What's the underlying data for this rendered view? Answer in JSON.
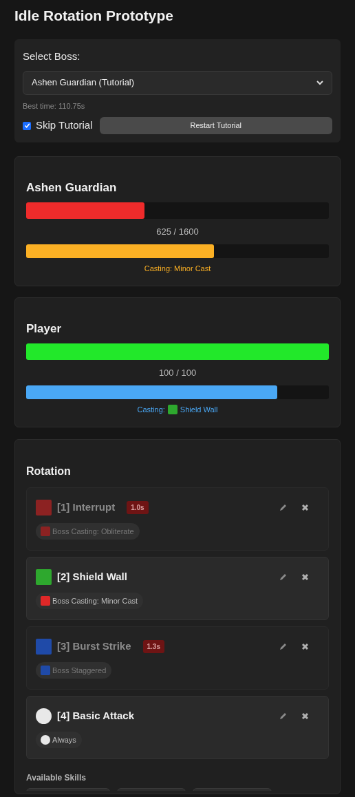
{
  "title": "Idle Rotation Prototype",
  "settings": {
    "label": "Select Boss:",
    "boss_select": "Ashen Guardian (Tutorial)",
    "best_time": "Best time: 110.75s",
    "skip_tutorial": {
      "label": "Skip Tutorial",
      "checked": true
    },
    "restart_button": "Restart Tutorial"
  },
  "units": [
    {
      "name": "Ashen Guardian",
      "kind": "boss",
      "health": {
        "level": 0.39,
        "color": "#ef2b2b"
      },
      "health_text": "625 / 1600",
      "cast": {
        "level": 0.62,
        "color": "#fbb024"
      },
      "cast_label": "Casting: Minor Cast"
    },
    {
      "name": "Player",
      "kind": "player",
      "health": {
        "level": 1.0,
        "color": "#22e82a"
      },
      "health_text": "100 / 100",
      "cast": {
        "level": 0.83,
        "color": "#4aa8f5"
      },
      "cast_label": "Casting:",
      "cast_skill": {
        "name": "Shield Wall",
        "color": "#2ea82e"
      }
    }
  ],
  "rotation": {
    "title": "Rotation",
    "items": [
      {
        "label": "[1] Interrupt",
        "kind": "square",
        "color": "#8c2222",
        "dimmed": true,
        "cooldown": "1.0s",
        "condition": {
          "text": "Boss Casting: Obliterate",
          "kind": "square",
          "color": "#8c2222"
        }
      },
      {
        "label": "[2] Shield Wall",
        "kind": "square",
        "color": "#2ea82e",
        "dimmed": false,
        "condition": {
          "text": "Boss Casting: Minor Cast",
          "kind": "square",
          "color": "#e02828"
        }
      },
      {
        "label": "[3] Burst Strike",
        "kind": "square",
        "color": "#1f4aa8",
        "dimmed": true,
        "cooldown": "1.3s",
        "condition": {
          "text": "Boss Staggered",
          "kind": "square",
          "color": "#1f4aa8"
        }
      },
      {
        "label": "[4] Basic Attack",
        "kind": "circle",
        "color": "#e8e8e8",
        "dimmed": false,
        "condition": {
          "text": "Always",
          "kind": "circle",
          "color": "#e8e8e8"
        }
      }
    ]
  },
  "available_skills": {
    "title": "Available Skills",
    "buttons": [
      {
        "kind": "skill"
      },
      {
        "kind": "skill"
      },
      {
        "kind": "skill"
      }
    ]
  }
}
